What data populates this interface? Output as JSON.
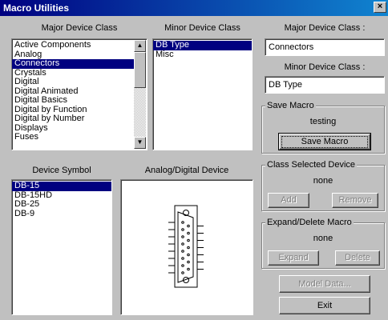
{
  "window": {
    "title": "Macro Utilities",
    "close_glyph": "×"
  },
  "labels": {
    "major_device_class": "Major Device Class",
    "minor_device_class": "Minor Device Class",
    "device_symbol": "Device Symbol",
    "analog_digital_device": "Analog/Digital Device",
    "major_device_class_field": "Major Device Class :",
    "minor_device_class_field": "Minor Device Class :"
  },
  "major_list": [
    "Active Components",
    "Analog",
    "Connectors",
    "Crystals",
    "Digital",
    "Digital Animated",
    "Digital Basics",
    "Digital by Function",
    "Digital by Number",
    "Displays",
    "Fuses"
  ],
  "minor_list": [
    "DB Type",
    "Misc"
  ],
  "symbol_list": [
    "DB-15",
    "DB-15HD",
    "DB-25",
    "DB-9"
  ],
  "fields": {
    "major_value": "Connectors",
    "minor_value": "DB Type"
  },
  "save_macro": {
    "title": "Save Macro",
    "name": "testing",
    "button": "Save Macro"
  },
  "class_selected": {
    "title": "Class Selected Device",
    "status": "none",
    "add": "Add",
    "remove": "Remove"
  },
  "expand_delete": {
    "title": "Expand/Delete Macro",
    "status": "none",
    "expand": "Expand",
    "delete": "Delete"
  },
  "buttons": {
    "model_data": "Model Data...",
    "exit": "Exit"
  },
  "icons": {
    "scroll_up": "▲",
    "scroll_down": "▼",
    "preview": "db15-connector-symbol"
  },
  "colors": {
    "titlebar_start": "#000080",
    "titlebar_end": "#1084d0",
    "selection": "#000080",
    "face": "#c0c0c0"
  }
}
